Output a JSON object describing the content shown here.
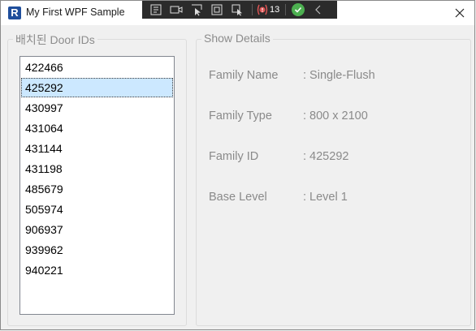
{
  "window": {
    "title": "My First WPF Sample",
    "app_icon_letter": "R"
  },
  "debug_toolbar": {
    "binding_errors_count": "13"
  },
  "left_group": {
    "header": "배치된 Door IDs",
    "items": [
      "422466",
      "425292",
      "430997",
      "431064",
      "431144",
      "431198",
      "485679",
      "505974",
      "906937",
      "939962",
      "940221"
    ],
    "selected_index": 1
  },
  "right_group": {
    "header": "Show Details",
    "rows": [
      {
        "label": "Family Name",
        "value": ": Single-Flush"
      },
      {
        "label": "Family Type",
        "value": ": 800 x 2100"
      },
      {
        "label": "Family ID",
        "value": ": 425292"
      },
      {
        "label": "Base Level",
        "value": ": Level 1"
      }
    ]
  },
  "colors": {
    "selection": "#cce8ff",
    "label_gray": "#8a8a8a",
    "toolbar_bg": "#2b2b2b",
    "brand": "#1f4e9c"
  }
}
